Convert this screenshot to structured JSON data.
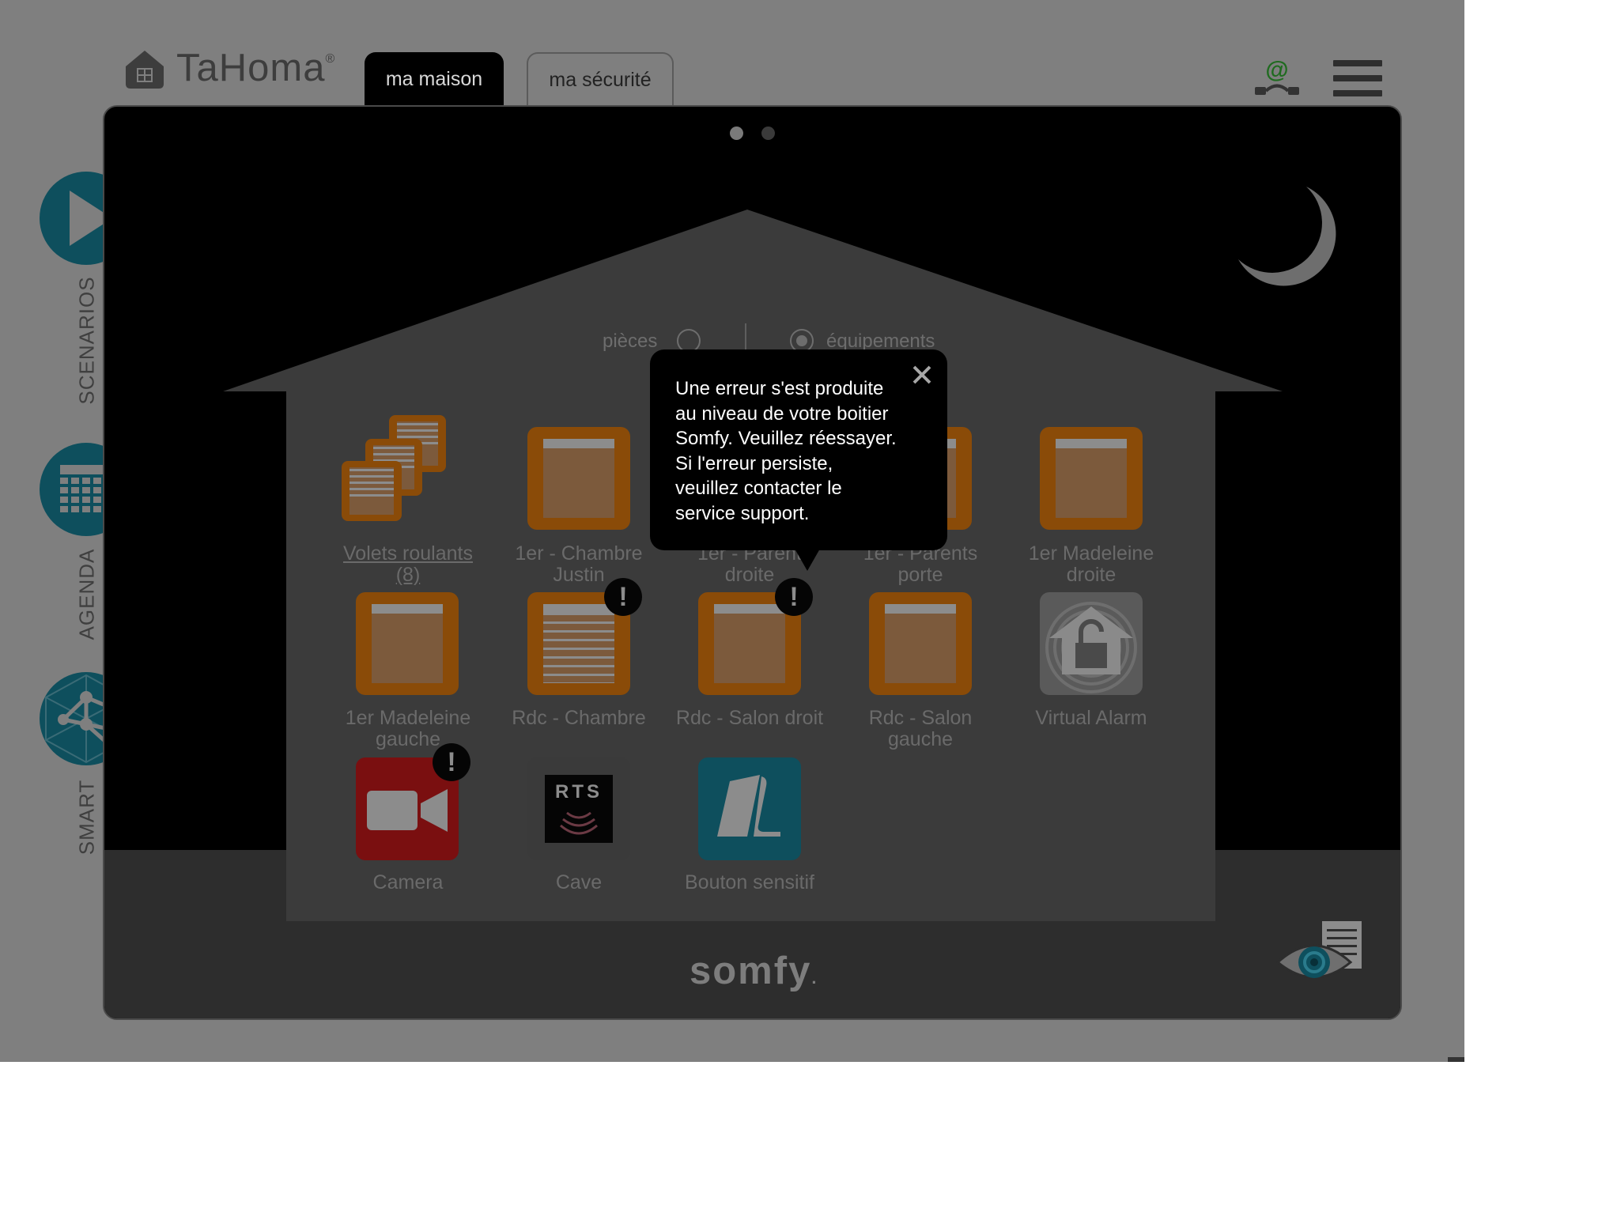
{
  "header": {
    "logo_text": "TaHoma",
    "logo_mark": "®",
    "tabs": [
      {
        "label": "ma maison",
        "active": true
      },
      {
        "label": "ma sécurité",
        "active": false
      }
    ],
    "connection_icon": "at-connection-icon",
    "menu_icon": "hamburger-menu-icon"
  },
  "sidebar": {
    "items": [
      {
        "label": "SCENARIOS",
        "icon": "play-icon"
      },
      {
        "label": "AGENDA",
        "icon": "calendar-icon"
      },
      {
        "label": "SMART",
        "icon": "network-icon"
      }
    ]
  },
  "view_toggle": {
    "rooms_label": "pièces",
    "devices_label": "équipements",
    "selected": "équipements"
  },
  "pagination": {
    "pages": 2,
    "current": 1
  },
  "devices": [
    {
      "label": "Volets roulants (8)",
      "kind": "group"
    },
    {
      "label": "1er - Chambre Justin",
      "kind": "shutter"
    },
    {
      "label": "1er - Parent droite",
      "kind": "shutter"
    },
    {
      "label": "1er - Parents porte",
      "kind": "shutter"
    },
    {
      "label": "1er Madeleine droite",
      "kind": "shutter"
    },
    {
      "label": "1er Madeleine gauche",
      "kind": "shutter"
    },
    {
      "label": "Rdc - Chambre",
      "kind": "blind",
      "error": true
    },
    {
      "label": "Rdc - Salon droit",
      "kind": "shutter",
      "error": true
    },
    {
      "label": "Rdc - Salon gauche",
      "kind": "shutter"
    },
    {
      "label": "Virtual Alarm",
      "kind": "alarm"
    },
    {
      "label": "Camera",
      "kind": "camera",
      "error": true
    },
    {
      "label": "Cave",
      "kind": "rts"
    },
    {
      "label": "Bouton sensitif",
      "kind": "sensor"
    }
  ],
  "rts_badge": "RTS",
  "warning_glyph": "!",
  "tooltip": {
    "lines": [
      "Une erreur s'est produite",
      "au niveau de votre boitier",
      "Somfy. Veuillez réessayer.",
      "Si l'erreur persiste,",
      "veuillez contacter le",
      "service support."
    ],
    "close_icon": "close-icon"
  },
  "footer": {
    "brand": "somfy",
    "brand_mark": ".",
    "eye_icon": "eye-document-icon"
  },
  "colors": {
    "backdrop": "#7f7f7f",
    "panel": "#000000",
    "teal": "#0e4f5d",
    "orange_tile": "#8a4b08",
    "camera_red": "#7a0f10",
    "sensor_teal": "#0e4f5d"
  }
}
